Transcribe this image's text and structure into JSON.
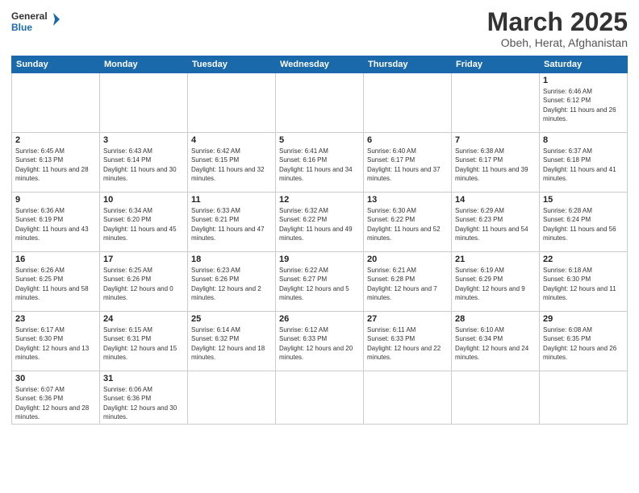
{
  "header": {
    "logo_general": "General",
    "logo_blue": "Blue",
    "month_title": "March 2025",
    "subtitle": "Obeh, Herat, Afghanistan"
  },
  "weekdays": [
    "Sunday",
    "Monday",
    "Tuesday",
    "Wednesday",
    "Thursday",
    "Friday",
    "Saturday"
  ],
  "weeks": [
    [
      {
        "day": "",
        "info": ""
      },
      {
        "day": "",
        "info": ""
      },
      {
        "day": "",
        "info": ""
      },
      {
        "day": "",
        "info": ""
      },
      {
        "day": "",
        "info": ""
      },
      {
        "day": "",
        "info": ""
      },
      {
        "day": "1",
        "info": "Sunrise: 6:46 AM\nSunset: 6:12 PM\nDaylight: 11 hours and 26 minutes."
      }
    ],
    [
      {
        "day": "2",
        "info": "Sunrise: 6:45 AM\nSunset: 6:13 PM\nDaylight: 11 hours and 28 minutes."
      },
      {
        "day": "3",
        "info": "Sunrise: 6:43 AM\nSunset: 6:14 PM\nDaylight: 11 hours and 30 minutes."
      },
      {
        "day": "4",
        "info": "Sunrise: 6:42 AM\nSunset: 6:15 PM\nDaylight: 11 hours and 32 minutes."
      },
      {
        "day": "5",
        "info": "Sunrise: 6:41 AM\nSunset: 6:16 PM\nDaylight: 11 hours and 34 minutes."
      },
      {
        "day": "6",
        "info": "Sunrise: 6:40 AM\nSunset: 6:17 PM\nDaylight: 11 hours and 37 minutes."
      },
      {
        "day": "7",
        "info": "Sunrise: 6:38 AM\nSunset: 6:17 PM\nDaylight: 11 hours and 39 minutes."
      },
      {
        "day": "8",
        "info": "Sunrise: 6:37 AM\nSunset: 6:18 PM\nDaylight: 11 hours and 41 minutes."
      }
    ],
    [
      {
        "day": "9",
        "info": "Sunrise: 6:36 AM\nSunset: 6:19 PM\nDaylight: 11 hours and 43 minutes."
      },
      {
        "day": "10",
        "info": "Sunrise: 6:34 AM\nSunset: 6:20 PM\nDaylight: 11 hours and 45 minutes."
      },
      {
        "day": "11",
        "info": "Sunrise: 6:33 AM\nSunset: 6:21 PM\nDaylight: 11 hours and 47 minutes."
      },
      {
        "day": "12",
        "info": "Sunrise: 6:32 AM\nSunset: 6:22 PM\nDaylight: 11 hours and 49 minutes."
      },
      {
        "day": "13",
        "info": "Sunrise: 6:30 AM\nSunset: 6:22 PM\nDaylight: 11 hours and 52 minutes."
      },
      {
        "day": "14",
        "info": "Sunrise: 6:29 AM\nSunset: 6:23 PM\nDaylight: 11 hours and 54 minutes."
      },
      {
        "day": "15",
        "info": "Sunrise: 6:28 AM\nSunset: 6:24 PM\nDaylight: 11 hours and 56 minutes."
      }
    ],
    [
      {
        "day": "16",
        "info": "Sunrise: 6:26 AM\nSunset: 6:25 PM\nDaylight: 11 hours and 58 minutes."
      },
      {
        "day": "17",
        "info": "Sunrise: 6:25 AM\nSunset: 6:26 PM\nDaylight: 12 hours and 0 minutes."
      },
      {
        "day": "18",
        "info": "Sunrise: 6:23 AM\nSunset: 6:26 PM\nDaylight: 12 hours and 2 minutes."
      },
      {
        "day": "19",
        "info": "Sunrise: 6:22 AM\nSunset: 6:27 PM\nDaylight: 12 hours and 5 minutes."
      },
      {
        "day": "20",
        "info": "Sunrise: 6:21 AM\nSunset: 6:28 PM\nDaylight: 12 hours and 7 minutes."
      },
      {
        "day": "21",
        "info": "Sunrise: 6:19 AM\nSunset: 6:29 PM\nDaylight: 12 hours and 9 minutes."
      },
      {
        "day": "22",
        "info": "Sunrise: 6:18 AM\nSunset: 6:30 PM\nDaylight: 12 hours and 11 minutes."
      }
    ],
    [
      {
        "day": "23",
        "info": "Sunrise: 6:17 AM\nSunset: 6:30 PM\nDaylight: 12 hours and 13 minutes."
      },
      {
        "day": "24",
        "info": "Sunrise: 6:15 AM\nSunset: 6:31 PM\nDaylight: 12 hours and 15 minutes."
      },
      {
        "day": "25",
        "info": "Sunrise: 6:14 AM\nSunset: 6:32 PM\nDaylight: 12 hours and 18 minutes."
      },
      {
        "day": "26",
        "info": "Sunrise: 6:12 AM\nSunset: 6:33 PM\nDaylight: 12 hours and 20 minutes."
      },
      {
        "day": "27",
        "info": "Sunrise: 6:11 AM\nSunset: 6:33 PM\nDaylight: 12 hours and 22 minutes."
      },
      {
        "day": "28",
        "info": "Sunrise: 6:10 AM\nSunset: 6:34 PM\nDaylight: 12 hours and 24 minutes."
      },
      {
        "day": "29",
        "info": "Sunrise: 6:08 AM\nSunset: 6:35 PM\nDaylight: 12 hours and 26 minutes."
      }
    ],
    [
      {
        "day": "30",
        "info": "Sunrise: 6:07 AM\nSunset: 6:36 PM\nDaylight: 12 hours and 28 minutes."
      },
      {
        "day": "31",
        "info": "Sunrise: 6:06 AM\nSunset: 6:36 PM\nDaylight: 12 hours and 30 minutes."
      },
      {
        "day": "",
        "info": ""
      },
      {
        "day": "",
        "info": ""
      },
      {
        "day": "",
        "info": ""
      },
      {
        "day": "",
        "info": ""
      },
      {
        "day": "",
        "info": ""
      }
    ]
  ]
}
